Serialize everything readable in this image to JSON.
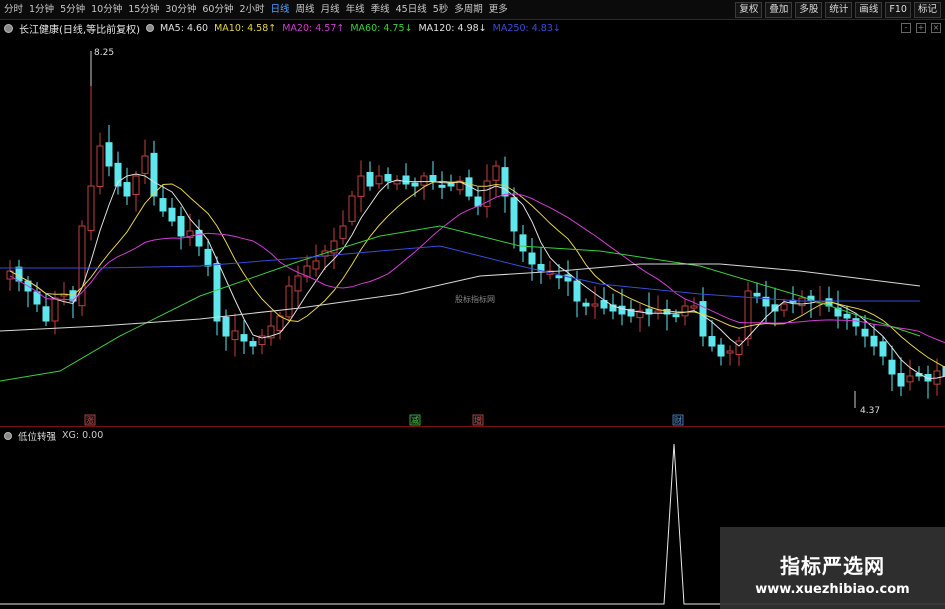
{
  "toolbar": {
    "tabs": [
      {
        "label": "分时",
        "active": false
      },
      {
        "label": "1分钟",
        "active": false
      },
      {
        "label": "5分钟",
        "active": false
      },
      {
        "label": "10分钟",
        "active": false
      },
      {
        "label": "15分钟",
        "active": false
      },
      {
        "label": "30分钟",
        "active": false
      },
      {
        "label": "60分钟",
        "active": false
      },
      {
        "label": "2小时",
        "active": false
      },
      {
        "label": "日线",
        "active": true
      },
      {
        "label": "周线",
        "active": false
      },
      {
        "label": "月线",
        "active": false
      },
      {
        "label": "年线",
        "active": false
      },
      {
        "label": "季线",
        "active": false
      },
      {
        "label": "45日线",
        "active": false
      },
      {
        "label": "5秒",
        "active": false
      },
      {
        "label": "多周期",
        "active": false
      },
      {
        "label": "更多",
        "active": false
      }
    ],
    "right_tools": [
      "复权",
      "叠加",
      "多股",
      "统计",
      "画线",
      "F10",
      "标记"
    ]
  },
  "header": {
    "stock_name": "长江健康(日线,等比前复权)",
    "ma": [
      {
        "label": "MA5: 4.60",
        "color": "#e0e0e0"
      },
      {
        "label": "MA10: 4.58↑",
        "color": "#e6d24a"
      },
      {
        "label": "MA20: 4.57↑",
        "color": "#d23cd2"
      },
      {
        "label": "MA60: 4.75↓",
        "color": "#3ccf3c"
      },
      {
        "label": "MA120: 4.98↓",
        "color": "#e0e0e0"
      },
      {
        "label": "MA250: 4.83↓",
        "color": "#3a4bd6"
      }
    ],
    "panel_buttons": [
      "-",
      "+",
      "×"
    ]
  },
  "main_chart": {
    "high_label": "8.25",
    "low_label": "4.37",
    "center_watermark": "股标指标网",
    "markers": [
      {
        "label": "涨",
        "color": "#d04a4a"
      },
      {
        "label": "减",
        "color": "#3ecf3e"
      },
      {
        "label": "增",
        "color": "#d04a4a"
      },
      {
        "label": "财",
        "color": "#4e8ad8"
      }
    ]
  },
  "sub_chart": {
    "name": "低位转强",
    "xg_label": "XG: 0.00"
  },
  "watermark": {
    "cn": "指标严选网",
    "url": "www.xuezhibiao.com"
  },
  "colors": {
    "up": "#c04040",
    "down": "#5ee8ee",
    "ma5": "#e0e0e0",
    "ma10": "#e6d24a",
    "ma20": "#d23cd2",
    "ma60": "#3ccf3c",
    "ma120": "#d8d8d8",
    "ma250": "#3a4bd6",
    "divider": "#7a1111"
  }
}
